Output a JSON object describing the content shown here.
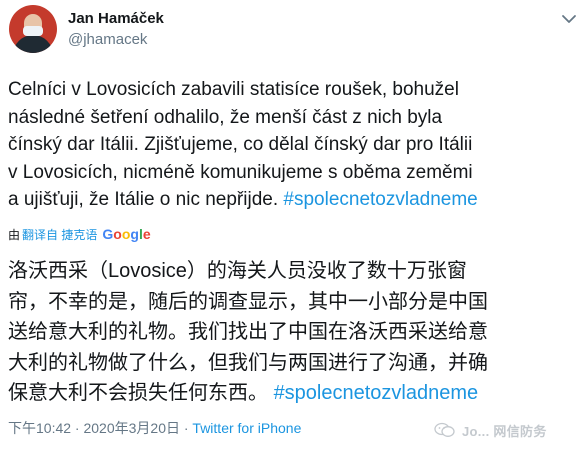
{
  "author": {
    "name": "Jan Hamáček",
    "handle": "@jhamacek"
  },
  "tweet": {
    "body_cs_lines": [
      "Celníci v Lovosicích zabavili statisíce roušek, bohužel",
      "následné šetření odhalilo, že menší část z nich byla",
      "čínský dar Itálii. Zjišťujeme, co dělal čínský dar pro Itálii",
      "v Lovosicích, nicméně komunikujeme s oběma zeměmi",
      "a ujišťuji, že Itálie o nic nepřijde. "
    ],
    "hashtag": "#spolecnetozvladneme"
  },
  "translation": {
    "prefix": "由",
    "link_label": "翻译自 捷克语",
    "google_letters": [
      "G",
      "o",
      "o",
      "g",
      "l",
      "e"
    ],
    "body_zh_lines": [
      "洛沃西采（Lovosice）的海关人员没收了数十万张窗",
      "帘，不幸的是，随后的调查显示，其中一小部分是中国",
      "送给意大利的礼物。我们找出了中国在洛沃西采送给意",
      "大利的礼物做了什么，但我们与两国进行了沟通，并确",
      "保意大利不会损失任何东西。 "
    ],
    "hashtag": "#spolecnetozvladneme"
  },
  "meta": {
    "timestamp": "下午10:42 · 2020年3月20日 · ",
    "source": "Twitter for iPhone"
  },
  "watermark": {
    "text": "Jo... 网信防务"
  },
  "icons": {
    "chevron": "chevron-down-icon",
    "watermark": "wechat-icon"
  },
  "colors": {
    "link": "#1b95e0",
    "secondary": "#657786",
    "text": "#14171a"
  }
}
